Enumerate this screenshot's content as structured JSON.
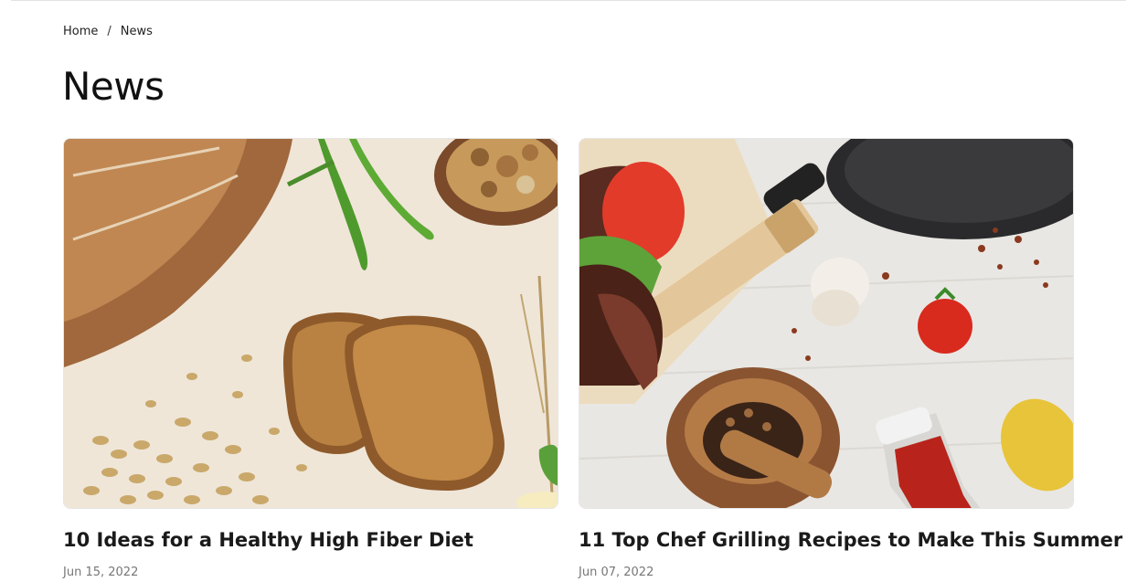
{
  "breadcrumb": {
    "home": "Home",
    "separator": "/",
    "current": "News"
  },
  "page": {
    "title": "News"
  },
  "posts": [
    {
      "title": "10 Ideas for a Healthy High Fiber Diet",
      "date": "Jun 15, 2022"
    },
    {
      "title": "11 Top Chef Grilling Recipes to Make This Summer",
      "date": "Jun 07, 2022"
    }
  ]
}
